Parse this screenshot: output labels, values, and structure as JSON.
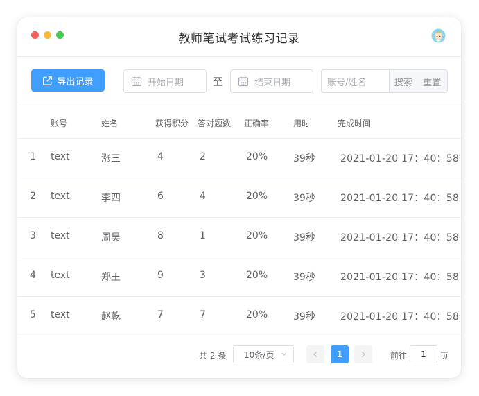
{
  "window": {
    "title": "教师笔试考试练习记录"
  },
  "toolbar": {
    "export_label": "导出记录",
    "start_date_placeholder": "开始日期",
    "separator": "至",
    "end_date_placeholder": "结束日期",
    "search_placeholder": "账号/姓名",
    "search_label": "搜索",
    "reset_label": "重置"
  },
  "table": {
    "headers": [
      "账号",
      "姓名",
      "获得积分",
      "答对题数",
      "正确率",
      "用时",
      "完成时间"
    ],
    "rows": [
      {
        "index": "1",
        "account": "text",
        "name": "涨三",
        "score": "4",
        "correct": "2",
        "rate": "20%",
        "time": "39秒",
        "finished": "2021-01-20  17：40：58"
      },
      {
        "index": "2",
        "account": "text",
        "name": "李四",
        "score": "6",
        "correct": "4",
        "rate": "20%",
        "time": "39秒",
        "finished": "2021-01-20  17：40：58"
      },
      {
        "index": "3",
        "account": "text",
        "name": "周昊",
        "score": "8",
        "correct": "1",
        "rate": "20%",
        "time": "39秒",
        "finished": "2021-01-20  17：40：58"
      },
      {
        "index": "4",
        "account": "text",
        "name": "郑王",
        "score": "9",
        "correct": "3",
        "rate": "20%",
        "time": "39秒",
        "finished": "2021-01-20  17：40：58"
      },
      {
        "index": "5",
        "account": "text",
        "name": "赵乾",
        "score": "7",
        "correct": "7",
        "rate": "20%",
        "time": "39秒",
        "finished": "2021-01-20  17：40：58"
      }
    ]
  },
  "pagination": {
    "total_text": "共 2 条",
    "page_size": "10条/页",
    "current_page": "1",
    "goto_label": "前往",
    "goto_value": "1",
    "page_unit": "页"
  },
  "colors": {
    "primary": "#409eff",
    "red_light": "#f25b56",
    "yellow_light": "#f6b93b",
    "green_light": "#3ec74a"
  },
  "icons": [
    "export-icon",
    "calendar-icon",
    "chevron-left-icon",
    "chevron-right-icon",
    "chevron-down-icon",
    "avatar"
  ]
}
